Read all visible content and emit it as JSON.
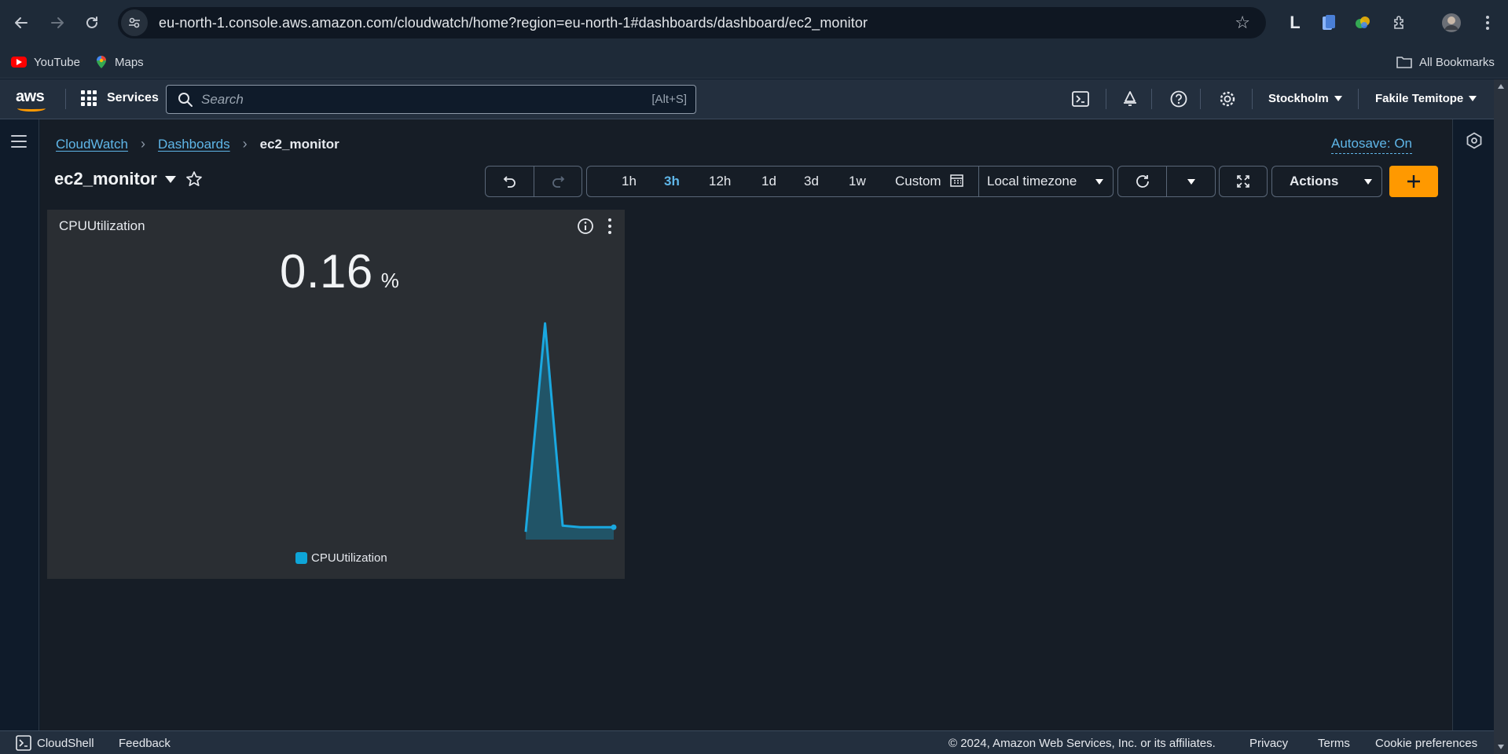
{
  "browser": {
    "url": "eu-north-1.console.aws.amazon.com/cloudwatch/home?region=eu-north-1#dashboards/dashboard/ec2_monitor",
    "extension_letter": "L",
    "bookmarks": [
      {
        "label": "YouTube",
        "icon": "youtube-icon"
      },
      {
        "label": "Maps",
        "icon": "maps-pin-icon"
      }
    ],
    "all_bookmarks_label": "All Bookmarks"
  },
  "aws_nav": {
    "logo": "aws",
    "services_label": "Services",
    "search_placeholder": "Search",
    "search_shortcut": "[Alt+S]",
    "region": "Stockholm",
    "user": "Fakile Temitope"
  },
  "breadcrumb": {
    "items": [
      "CloudWatch",
      "Dashboards"
    ],
    "current": "ec2_monitor"
  },
  "autosave_label": "Autosave: On",
  "dashboard": {
    "title": "ec2_monitor",
    "time_ranges": [
      "1h",
      "3h",
      "12h",
      "1d",
      "3d",
      "1w"
    ],
    "active_time_range": "3h",
    "custom_label": "Custom",
    "timezone": "Local timezone",
    "actions_label": "Actions"
  },
  "widget": {
    "title": "CPUUtilization",
    "value": "0.16",
    "unit": "%",
    "legend": "CPUUtilization"
  },
  "chart_data": {
    "type": "area",
    "series": [
      {
        "name": "CPUUtilization",
        "values": [
          0.1,
          2.8,
          0.18,
          0.16,
          0.16,
          0.16
        ]
      }
    ],
    "ylim": [
      0,
      3
    ],
    "grid": false,
    "color": "#0ea5d8"
  },
  "footer": {
    "cloudshell_label": "CloudShell",
    "feedback_label": "Feedback",
    "copyright": "© 2024, Amazon Web Services, Inc. or its affiliates.",
    "privacy_label": "Privacy",
    "terms_label": "Terms",
    "cookie_label": "Cookie preferences"
  },
  "colors": {
    "accent": "#5fb6e8",
    "primary_button": "#ff9900",
    "nav_background": "#232f3e",
    "series": "#0ea5d8"
  }
}
